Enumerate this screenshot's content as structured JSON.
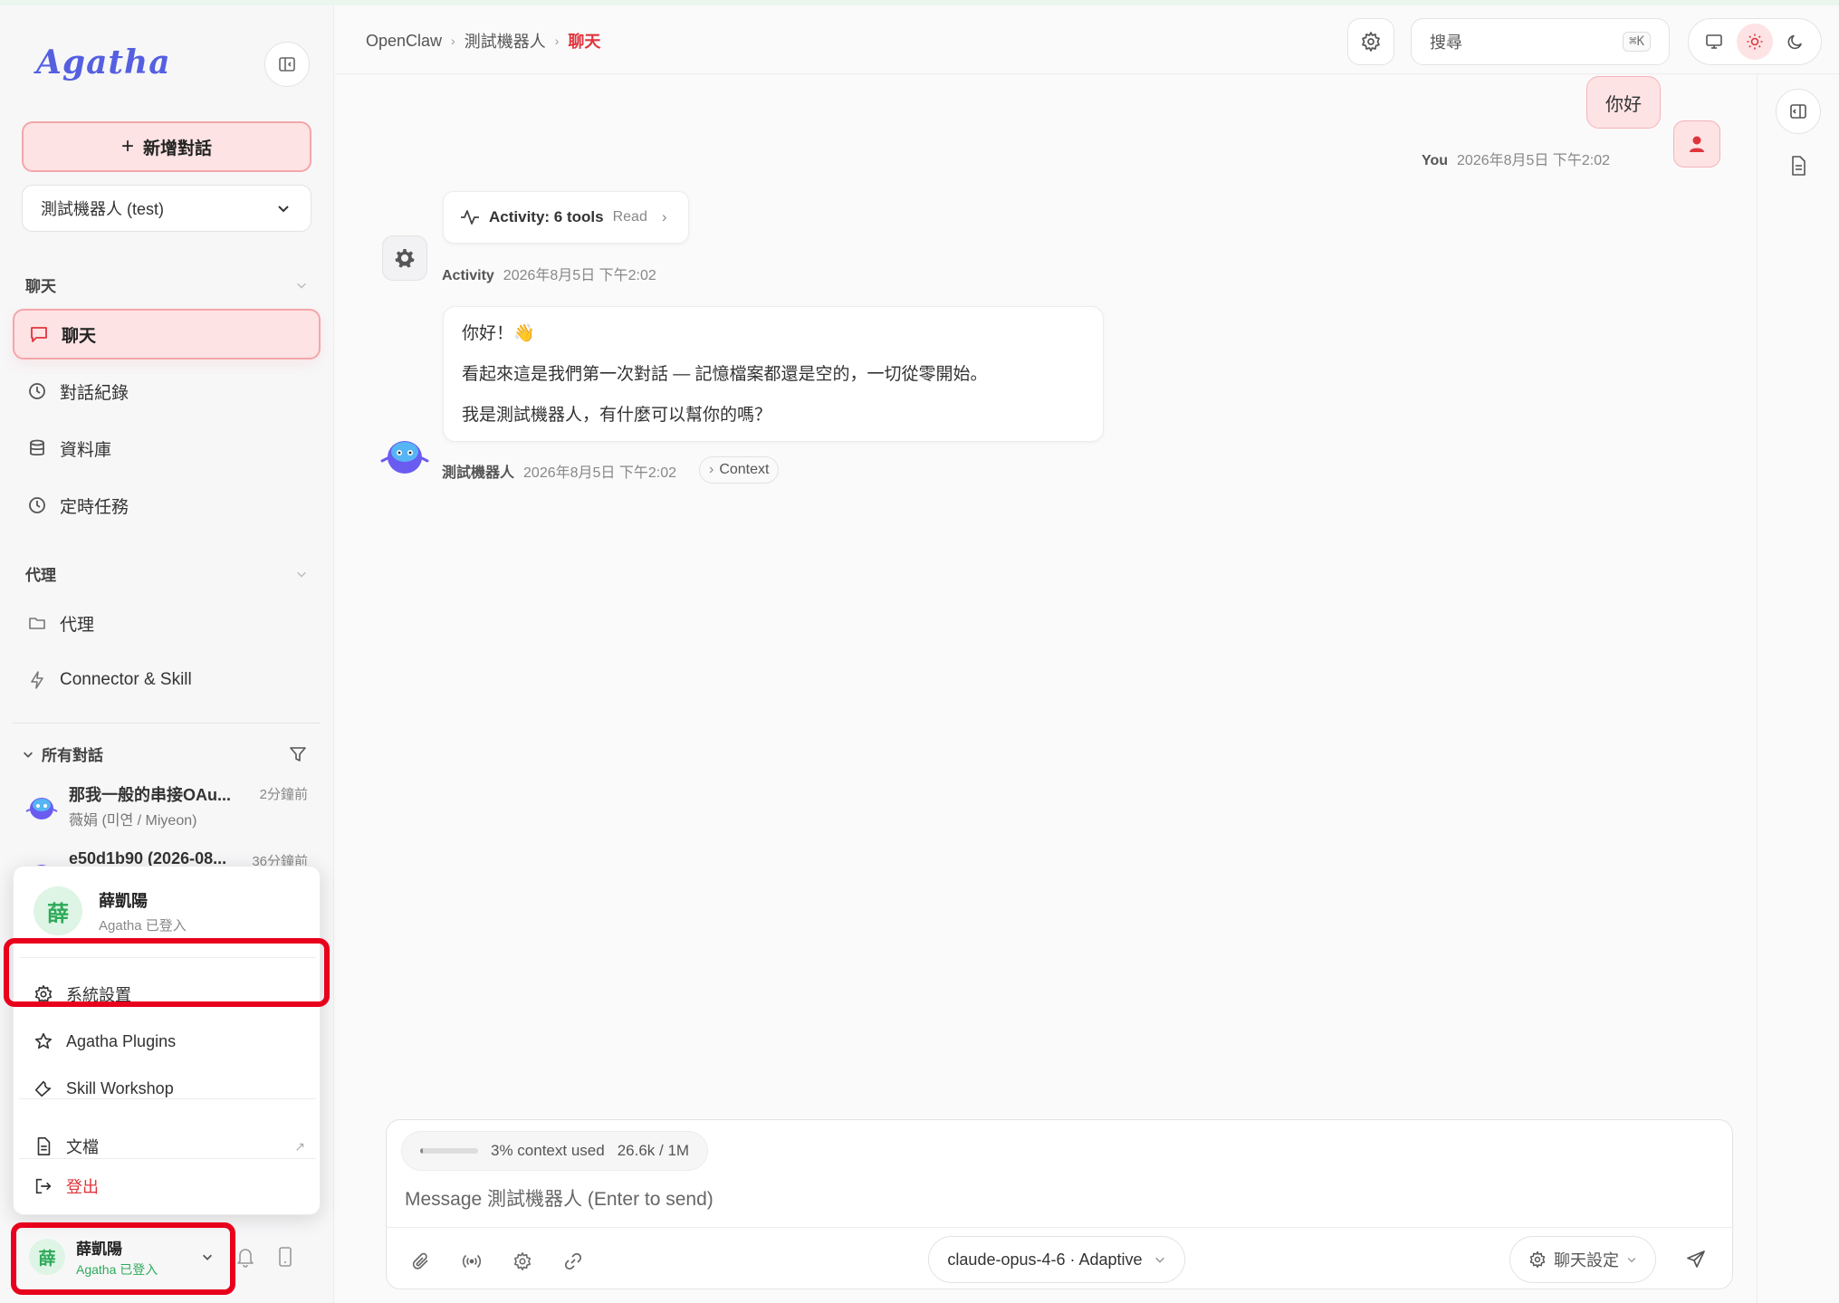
{
  "app": {
    "logo": "Agatha"
  },
  "sidebar": {
    "new_chat_label": "新增對話",
    "agent_select": "測試機器人 (test)",
    "chat_section_label": "聊天",
    "nav_items": [
      {
        "label": "聊天",
        "icon": "chat-bubble-icon"
      },
      {
        "label": "對話紀錄",
        "icon": "clock-icon"
      },
      {
        "label": "資料庫",
        "icon": "database-icon"
      },
      {
        "label": "定時任務",
        "icon": "clock-icon"
      }
    ],
    "agent_section_label": "代理",
    "agent_items": [
      {
        "label": "代理",
        "icon": "folder-icon"
      },
      {
        "label": "Connector & Skill",
        "icon": "lightning-icon"
      }
    ],
    "conversations_label": "所有對話",
    "conversations": [
      {
        "title": "那我一般的串接OAu...",
        "time": "2分鐘前",
        "subtitle": "薇娟 (미연 / Miyeon)"
      },
      {
        "title": "e50d1b90 (2026-08...",
        "time": "36分鐘前",
        "subtitle": ""
      }
    ]
  },
  "user_menu": {
    "avatar_char": "薛",
    "name": "薛凱陽",
    "status": "Agatha 已登入",
    "items": [
      {
        "label": "系統設置",
        "icon": "gear-icon"
      },
      {
        "label": "Agatha Plugins",
        "icon": "star-icon"
      },
      {
        "label": "Skill Workshop",
        "icon": "wrench-icon"
      },
      {
        "label": "文檔",
        "icon": "document-icon",
        "external": "↗"
      },
      {
        "label": "登出",
        "icon": "logout-icon"
      }
    ]
  },
  "user_bar": {
    "avatar_char": "薛",
    "name": "薛凱陽",
    "status": "Agatha 已登入"
  },
  "header": {
    "breadcrumb": [
      "OpenClaw",
      "測試機器人",
      "聊天"
    ],
    "search_placeholder": "搜尋",
    "search_shortcut": "⌘K"
  },
  "messages": {
    "user_text": "你好",
    "user_author": "You",
    "user_time": "2026年8月5日 下午2:02",
    "activity_label": "Activity: 6 tools",
    "activity_tool": "Read",
    "activity_author": "Activity",
    "activity_time": "2026年8月5日 下午2:02",
    "bot_lines": [
      "你好！👋",
      "看起來這是我們第一次對話 — 記憶檔案都還是空的，一切從零開始。",
      "我是測試機器人，有什麼可以幫你的嗎？"
    ],
    "bot_author": "測試機器人",
    "bot_time": "2026年8月5日 下午2:02",
    "context_label": "Context"
  },
  "composer": {
    "context_used": "3% context used",
    "context_fraction": 0.03,
    "context_tokens": "26.6k / 1M",
    "placeholder": "Message 測試機器人 (Enter to send)",
    "model": "claude-opus-4-6 · Adaptive",
    "chat_settings_label": "聊天設定"
  },
  "colors": {
    "accent": "#e0343c",
    "accent_soft": "#fde3e4",
    "highlight_box": "#e8001c",
    "avatar_green": "#2eaa5a"
  }
}
